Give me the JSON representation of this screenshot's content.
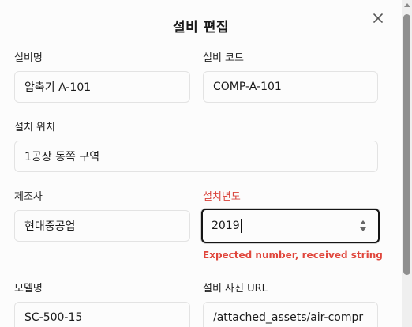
{
  "dialog": {
    "title": "설비 편집"
  },
  "form": {
    "equipment_name": {
      "label": "설비명",
      "value": "압축기 A-101"
    },
    "equipment_code": {
      "label": "설비 코드",
      "value": "COMP-A-101"
    },
    "location": {
      "label": "설치 위치",
      "value": "1공장 동쪽 구역"
    },
    "manufacturer": {
      "label": "제조사",
      "value": "현대중공업"
    },
    "install_year": {
      "label": "설치년도",
      "value": "2019",
      "error": "Expected number, received string"
    },
    "model": {
      "label": "모델명",
      "value": "SC-500-15"
    },
    "photo_url": {
      "label": "설비 사진 URL",
      "value": "/attached_assets/air-compr"
    }
  },
  "colors": {
    "error": "#e0463c",
    "focus_border": "#141414"
  },
  "icons": {
    "close": "close-icon",
    "spinner": "spinner-icon"
  }
}
